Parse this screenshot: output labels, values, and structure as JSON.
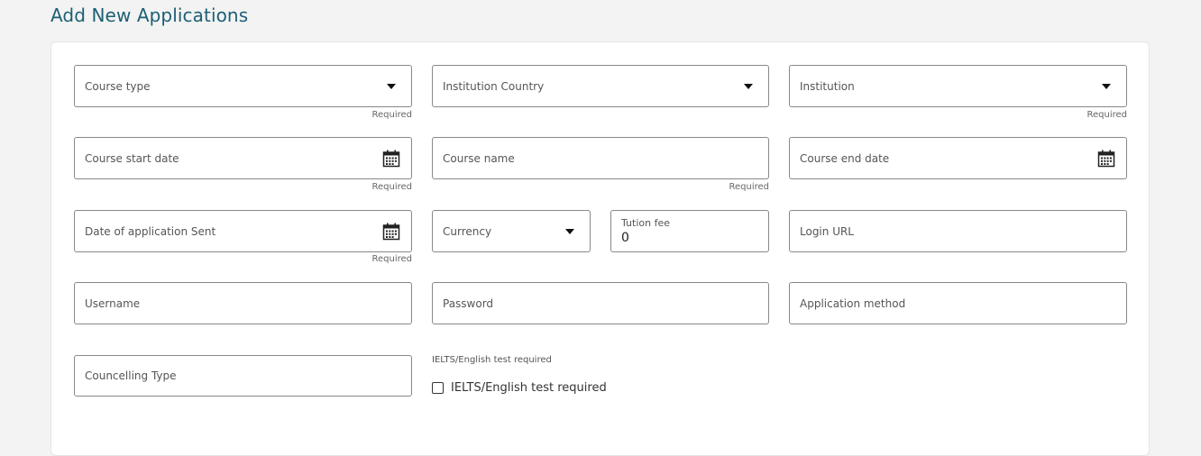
{
  "page": {
    "title": "Add New Applications"
  },
  "form": {
    "course_type": {
      "label": "Course type",
      "required": "Required"
    },
    "institution_country": {
      "label": "Institution Country"
    },
    "institution": {
      "label": "Institution",
      "required": "Required"
    },
    "course_start_date": {
      "label": "Course start date",
      "required": "Required"
    },
    "course_name": {
      "label": "Course name",
      "required": "Required"
    },
    "course_end_date": {
      "label": "Course end date"
    },
    "date_application_sent": {
      "label": "Date of application Sent",
      "required": "Required"
    },
    "currency": {
      "label": "Currency"
    },
    "tution_fee": {
      "label": "Tution fee",
      "value": "0"
    },
    "login_url": {
      "label": "Login URL"
    },
    "username": {
      "label": "Username"
    },
    "password": {
      "label": "Password"
    },
    "application_method": {
      "label": "Application method"
    },
    "councelling_type": {
      "label": "Councelling Type"
    },
    "ielts": {
      "caption": "IELTS/English test required",
      "label": "IELTS/English test required",
      "checked": false
    }
  },
  "icons": {
    "dropdown": "chevron-down-icon",
    "calendar": "calendar-icon"
  },
  "colors": {
    "title": "#1d5f75",
    "background": "#f2f3f2",
    "border": "#888888"
  }
}
